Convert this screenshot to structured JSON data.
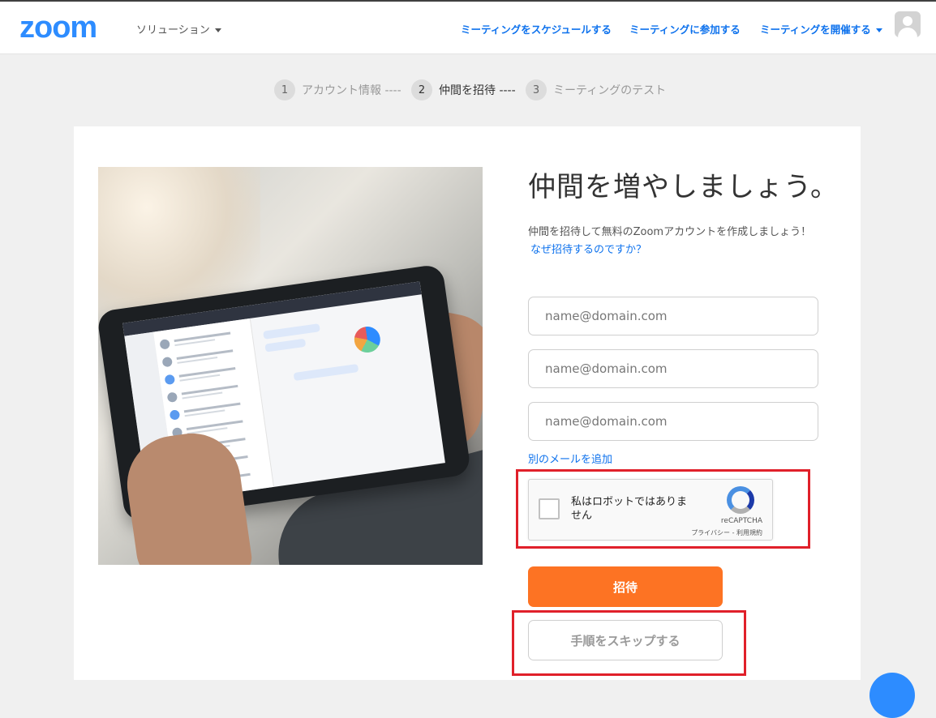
{
  "header": {
    "logo": "zoom",
    "solutions_label": "ソリューション",
    "nav": [
      {
        "label": "ミーティングをスケジュールする"
      },
      {
        "label": "ミーティングに参加する"
      },
      {
        "label": "ミーティングを開催する"
      }
    ]
  },
  "steps": [
    {
      "num": "1",
      "label": "アカウント情報 ----"
    },
    {
      "num": "2",
      "label": "仲間を招待 ----"
    },
    {
      "num": "3",
      "label": "ミーティングのテスト"
    }
  ],
  "main": {
    "title": "仲間を増やしましょう。",
    "description": "仲間を招待して無料のZoomアカウントを作成しましょう！",
    "why_link": "なぜ招待するのですか？",
    "emails": [
      {
        "placeholder": "name@domain.com",
        "value": ""
      },
      {
        "placeholder": "name@domain.com",
        "value": ""
      },
      {
        "placeholder": "name@domain.com",
        "value": ""
      }
    ],
    "add_email_link": "別のメールを追加",
    "recaptcha": {
      "label": "私はロボットではありません",
      "brand": "reCAPTCHA",
      "links": "プライバシー - 利用規約"
    },
    "invite_button": "招待",
    "skip_button": "手順をスキップする"
  },
  "colors": {
    "brand": "#2d8cff",
    "link": "#0e72ed",
    "invite": "#fd7323",
    "highlight": "#e0202a"
  },
  "icons": [
    "chevron-down-icon",
    "user-avatar-icon",
    "recaptcha-logo-icon",
    "help-chat-icon"
  ]
}
